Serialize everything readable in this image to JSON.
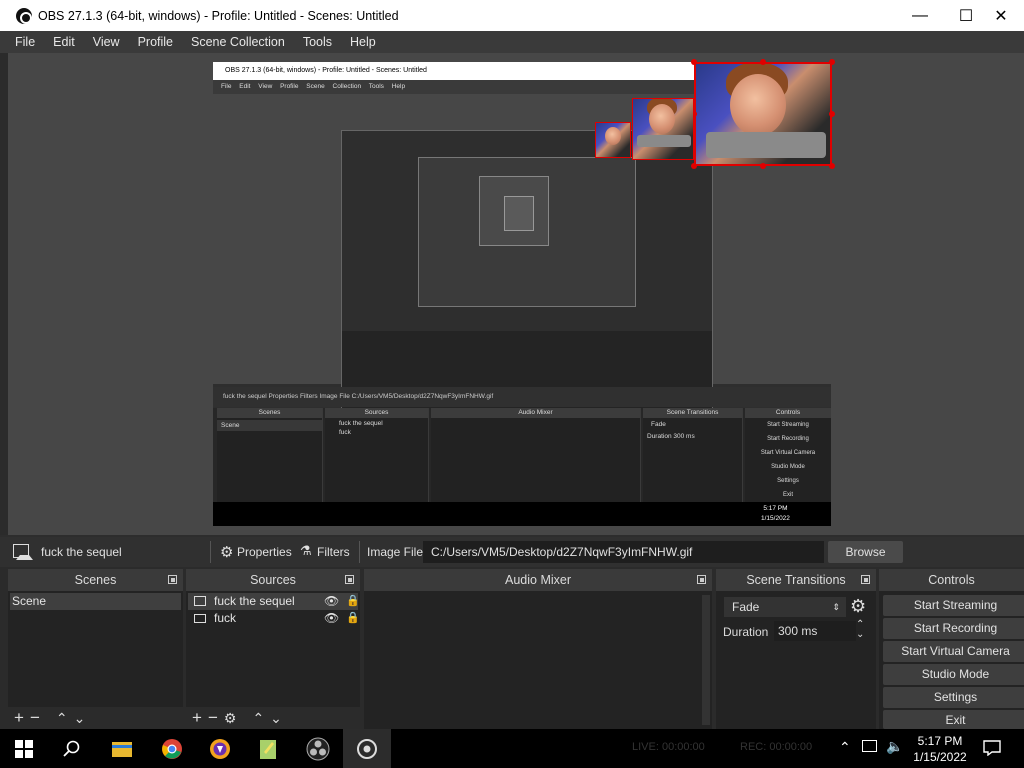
{
  "window": {
    "title": "OBS 27.1.3 (64-bit, windows) - Profile: Untitled - Scenes: Untitled",
    "minimize_glyph": "—",
    "maximize_glyph": "☐",
    "close_glyph": "✕"
  },
  "menu": [
    "File",
    "Edit",
    "View",
    "Profile",
    "Scene Collection",
    "Tools",
    "Help"
  ],
  "capture": {
    "title": "OBS 27.1.3 (64-bit, windows) - Profile: Untitled - Scenes: Untitled",
    "menu": "File Edit View Profile Scene Collection Tools Help",
    "toolbar": "fuck the sequel     Properties   Filters    Image File   C:/Users/VM5/Desktop/d2Z7NqwF3yImFNHW.gif",
    "browse": "Browse",
    "docks": [
      "Scenes",
      "Sources",
      "Audio Mixer",
      "Scene Transitions",
      "Controls"
    ],
    "scene": "Scene",
    "sources": [
      "fuck the sequel",
      "fuck"
    ],
    "transition": "Fade",
    "duration_label": "Duration",
    "duration": "300 ms",
    "controls": [
      "Start Streaming",
      "Start Recording",
      "Start Virtual Camera",
      "Studio Mode",
      "Settings",
      "Exit"
    ],
    "time": "5:17 PM",
    "date": "1/15/2022"
  },
  "toolbar": {
    "source_name": "fuck the sequel",
    "properties": "Properties",
    "filters": "Filters",
    "image_file_label": "Image File",
    "path": "C:/Users/VM5/Desktop/d2Z7NqwF3yImFNHW.gif",
    "browse": "Browse"
  },
  "scenes": {
    "header": "Scenes",
    "items": [
      "Scene"
    ]
  },
  "sources": {
    "header": "Sources",
    "items": [
      {
        "name": "fuck the sequel",
        "icon": "image-icon"
      },
      {
        "name": "fuck",
        "icon": "monitor-icon"
      }
    ]
  },
  "audio_mixer": {
    "header": "Audio Mixer"
  },
  "transitions": {
    "header": "Scene Transitions",
    "selected": "Fade",
    "duration_label": "Duration",
    "duration": "300 ms"
  },
  "controls": {
    "header": "Controls",
    "buttons": [
      "Start Streaming",
      "Start Recording",
      "Start Virtual Camera",
      "Studio Mode",
      "Settings",
      "Exit"
    ]
  },
  "status": {
    "live": "LIVE: 00:00:00",
    "rec": "REC: 00:00:00"
  },
  "taskbar": {
    "time": "5:17 PM",
    "date": "1/15/2022"
  },
  "colors": {
    "accent_red": "#e00000",
    "panel": "#232323",
    "header": "#3a3a3a"
  }
}
